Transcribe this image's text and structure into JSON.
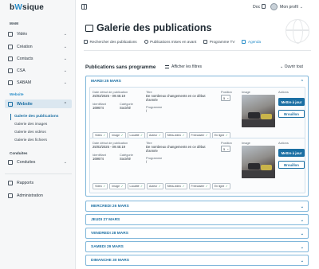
{
  "app": {
    "logo_prefix": "b",
    "logo_accent": "W",
    "logo_suffix": "sique"
  },
  "sidebar": {
    "sections": {
      "mam": "MAM",
      "website": "Website",
      "conduites": "Conduites"
    },
    "items": [
      {
        "label": "Vidéo",
        "icon": "video-icon"
      },
      {
        "label": "Création",
        "icon": "pencil-icon"
      },
      {
        "label": "Contacts",
        "icon": "contacts-icon"
      },
      {
        "label": "CSA",
        "icon": "csa-icon"
      },
      {
        "label": "SABAM",
        "icon": "sabam-icon"
      },
      {
        "label": "Website",
        "icon": "website-icon"
      },
      {
        "label": "Conduites",
        "icon": "conduites-icon"
      },
      {
        "label": "Rapports",
        "icon": "reports-icon"
      },
      {
        "label": "Administration",
        "icon": "admin-icon"
      }
    ],
    "website_sub": [
      "Galerie des publications",
      "Galerie des images",
      "Galerie des vidéos",
      "Galerie des fichiers"
    ]
  },
  "topbar": {
    "doc_label": "Doc",
    "profile_label": "Mon profil"
  },
  "page": {
    "title": "Galerie des publications",
    "tabs": [
      "Rechercher des publications",
      "Publications mises en avant",
      "Programme TV",
      "Agenda"
    ],
    "active_tab": 3,
    "subtitle": "Publications sans programme",
    "filters_label": "Afficher les filtres",
    "open_all_label": "Ouvrir tout"
  },
  "field_labels": {
    "date": "Date début de publication",
    "title": "Titre",
    "id": "Identifiant",
    "category": "Catégorie",
    "program": "Programme",
    "position": "Position",
    "image": "Image",
    "actions": "Actions"
  },
  "buttons": {
    "update": "Mettre à jour",
    "draft": "Brouillon"
  },
  "days": [
    {
      "label": "MARDI 25 MARS",
      "expanded": true,
      "entries": [
        {
          "date": "25/03/2025 - 09:45:19",
          "title": "De nombreux changements en ce début d'année",
          "id": "169674",
          "category": "Société",
          "program": "/",
          "position": "5",
          "tags": [
            "Vidéo",
            "Image",
            "Localité",
            "Auteur",
            "Méta-vidéo",
            "Freecaster",
            "En ligne"
          ]
        },
        {
          "date": "25/03/2025 - 09:45:19",
          "title": "De nombreux changements en ce début d'année",
          "id": "169674",
          "category": "Société",
          "program": "/",
          "position": "5",
          "tags": [
            "Vidéo",
            "Image",
            "Localité",
            "Auteur",
            "Méta-vidéo",
            "Freecaster",
            "En ligne"
          ]
        }
      ]
    },
    {
      "label": "MERCREDI 26 MARS",
      "expanded": false
    },
    {
      "label": "JEUDI 27 MARS",
      "expanded": false
    },
    {
      "label": "VENDREDI 28 MARS",
      "expanded": false
    },
    {
      "label": "SAMEDI 29 MARS",
      "expanded": false
    },
    {
      "label": "DIMANCHE 30 MARS",
      "expanded": false
    }
  ],
  "colors": {
    "accent": "#1b6fa3",
    "link": "#2a8ec9",
    "check": "#2e9d5b"
  }
}
